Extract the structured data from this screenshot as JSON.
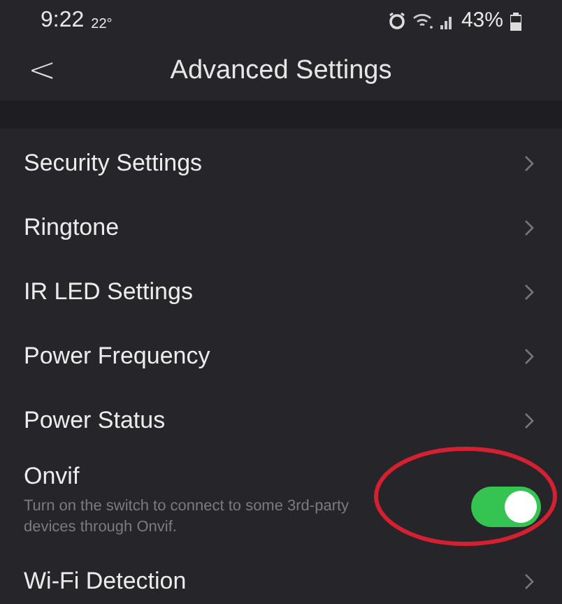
{
  "status_bar": {
    "time": "9:22",
    "temperature": "22°",
    "battery": "43%"
  },
  "header": {
    "back": "<",
    "title": "Advanced Settings"
  },
  "items": [
    {
      "kind": "link",
      "label": "Security Settings"
    },
    {
      "kind": "link",
      "label": "Ringtone"
    },
    {
      "kind": "link",
      "label": "IR LED Settings"
    },
    {
      "kind": "link",
      "label": "Power Frequency"
    },
    {
      "kind": "link",
      "label": "Power Status"
    },
    {
      "kind": "toggle",
      "label": "Onvif",
      "description": "Turn on the switch to connect to some 3rd-party devices through Onvif.",
      "on": true
    },
    {
      "kind": "link",
      "label": "Wi-Fi Detection"
    }
  ],
  "annotation": {
    "kind": "ellipse",
    "color": "#d42030"
  }
}
